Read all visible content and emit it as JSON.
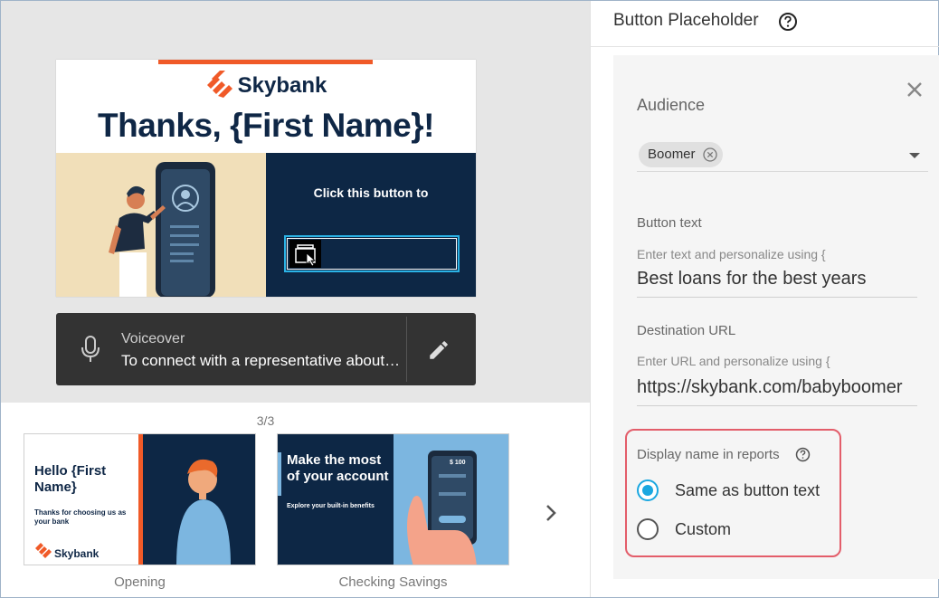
{
  "preview": {
    "brand": "Skybank",
    "headline": "Thanks, {First Name}!",
    "click_text": "Click this button to",
    "voiceover": {
      "label": "Voiceover",
      "text": "To connect with a representative about…"
    }
  },
  "filmstrip": {
    "counter": "3/3",
    "thumbs": [
      {
        "label": "Opening",
        "title": "Hello {First Name}",
        "subtitle": "Thanks for choosing us as your bank",
        "brand": "Skybank"
      },
      {
        "label": "Checking Savings",
        "title": "Make the most of your account",
        "subtitle": "Explore your built-in benefits",
        "amount": "$ 100"
      }
    ]
  },
  "panel": {
    "title": "Button Placeholder",
    "audience_label": "Audience",
    "audience_chip": "Boomer",
    "button_text_label": "Button text",
    "button_text_hint": "Enter text and personalize using {",
    "button_text_value": "Best loans for the best years",
    "dest_label": "Destination URL",
    "dest_hint": "Enter URL and personalize using {",
    "dest_value": "https://skybank.com/babyboomer",
    "display_label": "Display name in reports",
    "option_same": "Same as button text",
    "option_custom": "Custom"
  },
  "colors": {
    "accent": "#1aa7e0",
    "brand_orange": "#f05a28",
    "navy": "#0d2745",
    "highlight": "#e35d6a"
  },
  "icons": [
    "microphone-icon",
    "pencil-icon",
    "chevron-right-icon",
    "help-icon",
    "close-icon",
    "chip-remove-icon",
    "dropdown-arrow-icon",
    "button-cursor-icon"
  ]
}
